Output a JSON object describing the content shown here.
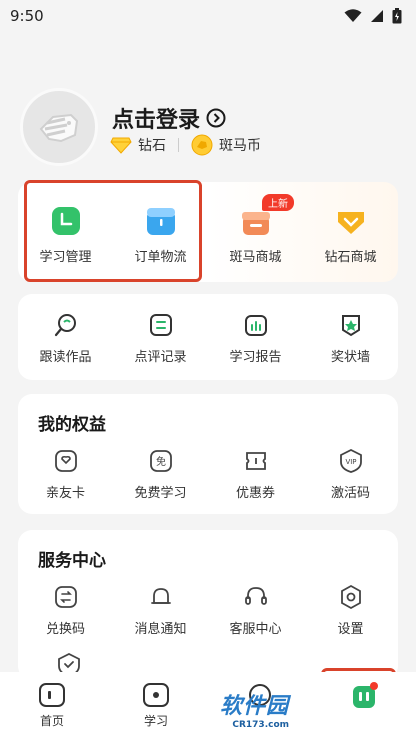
{
  "status": {
    "time": "9:50"
  },
  "profile": {
    "login_label": "点击登录",
    "asset1": "钻石",
    "asset2": "斑马币"
  },
  "quick": [
    {
      "label": "学习管理",
      "icon": "clock-icon",
      "color": "#33c26a"
    },
    {
      "label": "订单物流",
      "icon": "box-icon",
      "color": "#3aa6ee"
    },
    {
      "label": "斑马商城",
      "icon": "gift-icon",
      "color": "#f28a57",
      "badge": "上新"
    },
    {
      "label": "钻石商城",
      "icon": "diamond-icon",
      "color": "#f6b21f"
    }
  ],
  "works": [
    {
      "label": "跟读作品"
    },
    {
      "label": "点评记录"
    },
    {
      "label": "学习报告"
    },
    {
      "label": "奖状墙"
    }
  ],
  "rights": {
    "title": "我的权益",
    "items": [
      {
        "label": "亲友卡"
      },
      {
        "label": "免费学习",
        "glyph": "免"
      },
      {
        "label": "优惠券"
      },
      {
        "label": "激活码",
        "glyph": "VIP"
      }
    ]
  },
  "service": {
    "title": "服务中心",
    "items": [
      {
        "label": "兑换码"
      },
      {
        "label": "消息通知"
      },
      {
        "label": "客服中心"
      },
      {
        "label": "设置"
      }
    ]
  },
  "tabs": [
    {
      "label": "首页"
    },
    {
      "label": "学习"
    },
    {
      "label": ""
    },
    {
      "label": ""
    }
  ],
  "watermark": {
    "text": "软件园",
    "sub": "CR173.com"
  }
}
